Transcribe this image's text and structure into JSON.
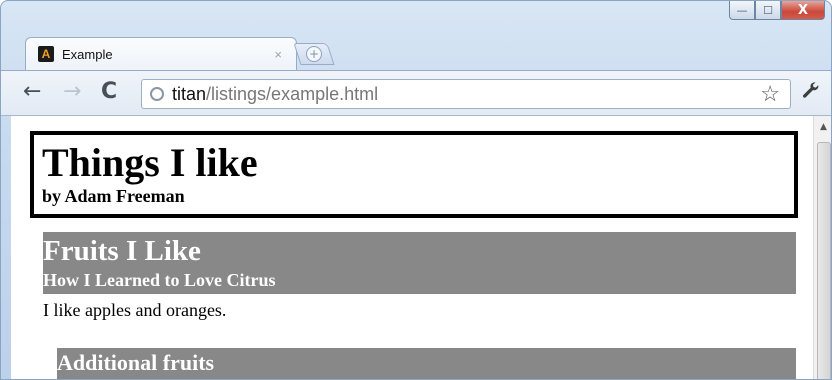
{
  "window": {
    "minimize_label": "—",
    "maximize_label": "☐",
    "close_label": "X"
  },
  "tab": {
    "favicon_letter": "A",
    "title": "Example",
    "close_label": "×",
    "new_tab_label": "+"
  },
  "toolbar": {
    "back_icon": "←",
    "forward_icon": "→",
    "reload_icon": "C",
    "url_host": "titan",
    "url_path": "/listings/example.html",
    "star_icon": "☆",
    "wrench_icon": "🔧"
  },
  "page": {
    "header_title": "Things I like",
    "header_subtitle": "by Adam Freeman",
    "section_title": "Fruits I Like",
    "section_subtitle": "How I Learned to Love Citrus",
    "paragraph": "I like apples and oranges.",
    "subsection_title": "Additional fruits"
  },
  "colors": {
    "section_background": "#888888",
    "border": "#000000"
  }
}
